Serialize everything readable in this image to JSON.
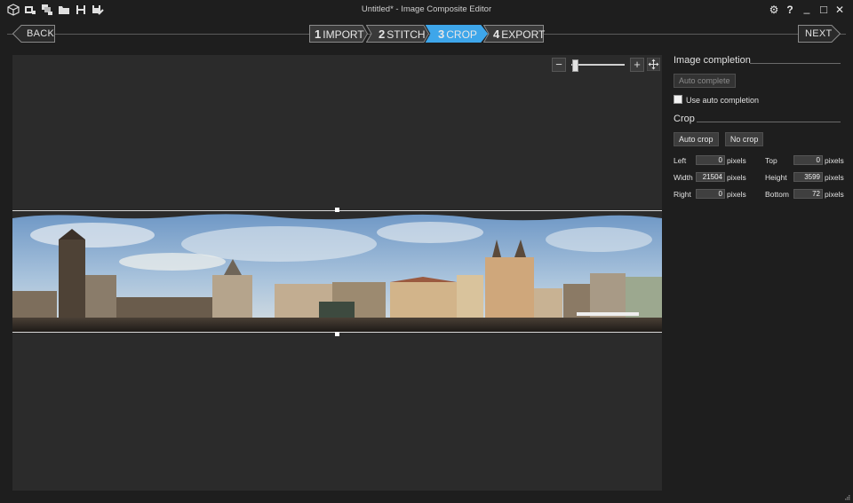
{
  "window": {
    "title": "Untitled* - Image Composite Editor",
    "toolbar_icons": [
      "new-panorama-icon",
      "new-from-video-icon",
      "new-image-set-icon",
      "open-folder-icon",
      "save-icon",
      "save-as-icon"
    ],
    "controls": {
      "settings": "⚙",
      "help": "?",
      "minimize": "_",
      "maximize": "□",
      "close": "✕"
    }
  },
  "nav": {
    "back_label": "BACK",
    "next_label": "NEXT",
    "steps": [
      {
        "num": "1",
        "label": "IMPORT",
        "active": false
      },
      {
        "num": "2",
        "label": "STITCH",
        "active": false
      },
      {
        "num": "3",
        "label": "CROP",
        "active": true
      },
      {
        "num": "4",
        "label": "EXPORT",
        "active": false
      }
    ],
    "accent_color": "#3ea6ea"
  },
  "zoom": {
    "minus": "−",
    "plus": "+",
    "fit_icon": "fit-to-window-icon",
    "level": 0.02
  },
  "panel": {
    "image_completion": {
      "title": "Image completion",
      "auto_complete_label": "Auto complete",
      "use_auto_completion_label": "Use auto completion",
      "use_auto_completion_checked": false
    },
    "crop": {
      "title": "Crop",
      "auto_crop_label": "Auto crop",
      "no_crop_label": "No crop",
      "fields": {
        "left": {
          "label": "Left",
          "value": "0",
          "unit": "pixels"
        },
        "top": {
          "label": "Top",
          "value": "0",
          "unit": "pixels"
        },
        "width": {
          "label": "Width",
          "value": "21504",
          "unit": "pixels"
        },
        "height": {
          "label": "Height",
          "value": "3599",
          "unit": "pixels"
        },
        "right": {
          "label": "Right",
          "value": "0",
          "unit": "pixels"
        },
        "bottom": {
          "label": "Bottom",
          "value": "72",
          "unit": "pixels"
        }
      }
    }
  }
}
